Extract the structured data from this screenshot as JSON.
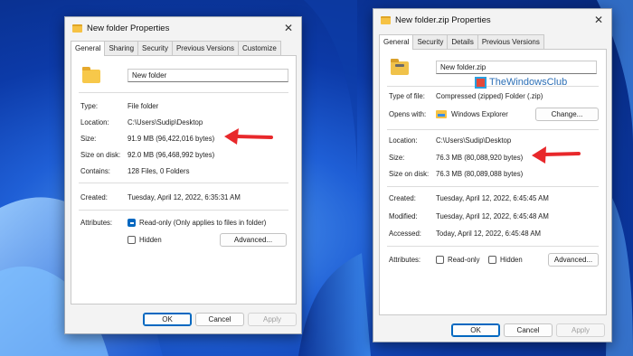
{
  "left_dialog": {
    "title": "New folder Properties",
    "close_glyph": "✕",
    "tabs": [
      "General",
      "Sharing",
      "Security",
      "Previous Versions",
      "Customize"
    ],
    "name_value": "New folder",
    "type_label": "Type:",
    "type_value": "File folder",
    "location_label": "Location:",
    "location_value": "C:\\Users\\Sudip\\Desktop",
    "size_label": "Size:",
    "size_value": "91.9 MB (96,422,016 bytes)",
    "size_on_disk_label": "Size on disk:",
    "size_on_disk_value": "92.0 MB (96,468,992 bytes)",
    "contains_label": "Contains:",
    "contains_value": "128 Files, 0 Folders",
    "created_label": "Created:",
    "created_value": "Tuesday, April 12, 2022, 6:35:31 AM",
    "attributes_label": "Attributes:",
    "readonly_label": "Read-only (Only applies to files in folder)",
    "hidden_label": "Hidden",
    "advanced_button": "Advanced...",
    "ok_button": "OK",
    "cancel_button": "Cancel",
    "apply_button": "Apply",
    "folder_icon": "folder-icon"
  },
  "right_dialog": {
    "title": "New folder.zip Properties",
    "close_glyph": "✕",
    "tabs": [
      "General",
      "Security",
      "Details",
      "Previous Versions"
    ],
    "name_value": "New folder.zip",
    "type_label": "Type of file:",
    "type_value": "Compressed (zipped) Folder (.zip)",
    "opens_with_label": "Opens with:",
    "opens_with_value": "Windows Explorer",
    "change_button": "Change...",
    "location_label": "Location:",
    "location_value": "C:\\Users\\Sudip\\Desktop",
    "size_label": "Size:",
    "size_value": "76.3 MB (80,088,920 bytes)",
    "size_on_disk_label": "Size on disk:",
    "size_on_disk_value": "76.3 MB (80,089,088 bytes)",
    "created_label": "Created:",
    "created_value": "Tuesday, April 12, 2022, 6:45:45 AM",
    "modified_label": "Modified:",
    "modified_value": "Tuesday, April 12, 2022, 6:45:48 AM",
    "accessed_label": "Accessed:",
    "accessed_value": "Today, April 12, 2022, 6:45:48 AM",
    "attributes_label": "Attributes:",
    "readonly_label": "Read-only",
    "hidden_label": "Hidden",
    "advanced_button": "Advanced...",
    "ok_button": "OK",
    "cancel_button": "Cancel",
    "apply_button": "Apply",
    "folder_icon": "zip-folder-icon"
  },
  "watermark": {
    "text": "TheWindowsClub"
  },
  "colors": {
    "accent": "#0067c0",
    "arrow": "#e8282b",
    "wallpaper": "#1f5fd6"
  }
}
